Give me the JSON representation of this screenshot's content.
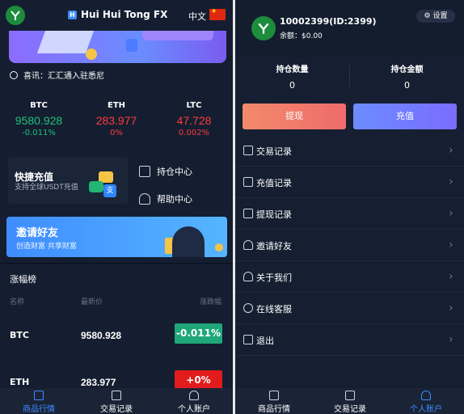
{
  "left": {
    "brand": "Hui Hui Tong FX",
    "brand_mark": "H",
    "lang": "中文",
    "notice": "喜讯：汇汇通入驻悉尼",
    "tickers": [
      {
        "name": "BTC",
        "price": "9580.928",
        "change": "-0.011%",
        "dir": "up"
      },
      {
        "name": "ETH",
        "price": "283.977",
        "change": "0%",
        "dir": "down"
      },
      {
        "name": "LTC",
        "price": "47.728",
        "change": "0.002%",
        "dir": "down"
      }
    ],
    "quick": {
      "title": "快捷充值",
      "subtitle": "支持全球USDT充值",
      "icon_text": "支",
      "position_center": "持仓中心",
      "help_center": "帮助中心"
    },
    "invite": {
      "title": "邀请好友",
      "subtitle": "创造财富 共享财富"
    },
    "rank": {
      "title": "涨幅榜",
      "headers": [
        "名称",
        "最新价",
        "涨跌幅"
      ],
      "rows": [
        {
          "sym": "BTC",
          "price": "9580.928",
          "change": "-0.011%",
          "color": "#1fa77a"
        },
        {
          "sym": "ETH",
          "price": "283.977",
          "change": "+0%",
          "color": "#e21c1c"
        }
      ]
    },
    "tabs": [
      "商品行情",
      "交易记录",
      "个人账户"
    ]
  },
  "right": {
    "user_id": "10002399(ID:2399)",
    "balance": "余额：$0.00",
    "settings": "设置",
    "stats": [
      {
        "label": "持仓数量",
        "value": "0"
      },
      {
        "label": "持仓金额",
        "value": "0"
      }
    ],
    "withdraw": "提现",
    "deposit": "充值",
    "menu": [
      "交易记录",
      "充值记录",
      "提现记录",
      "邀请好友",
      "关于我们",
      "在线客服",
      "退出"
    ],
    "tabs": [
      "商品行情",
      "交易记录",
      "个人账户"
    ]
  },
  "colors": {
    "green": "#21c27a",
    "red": "#ff3b3b",
    "accent": "#3d8bff"
  }
}
